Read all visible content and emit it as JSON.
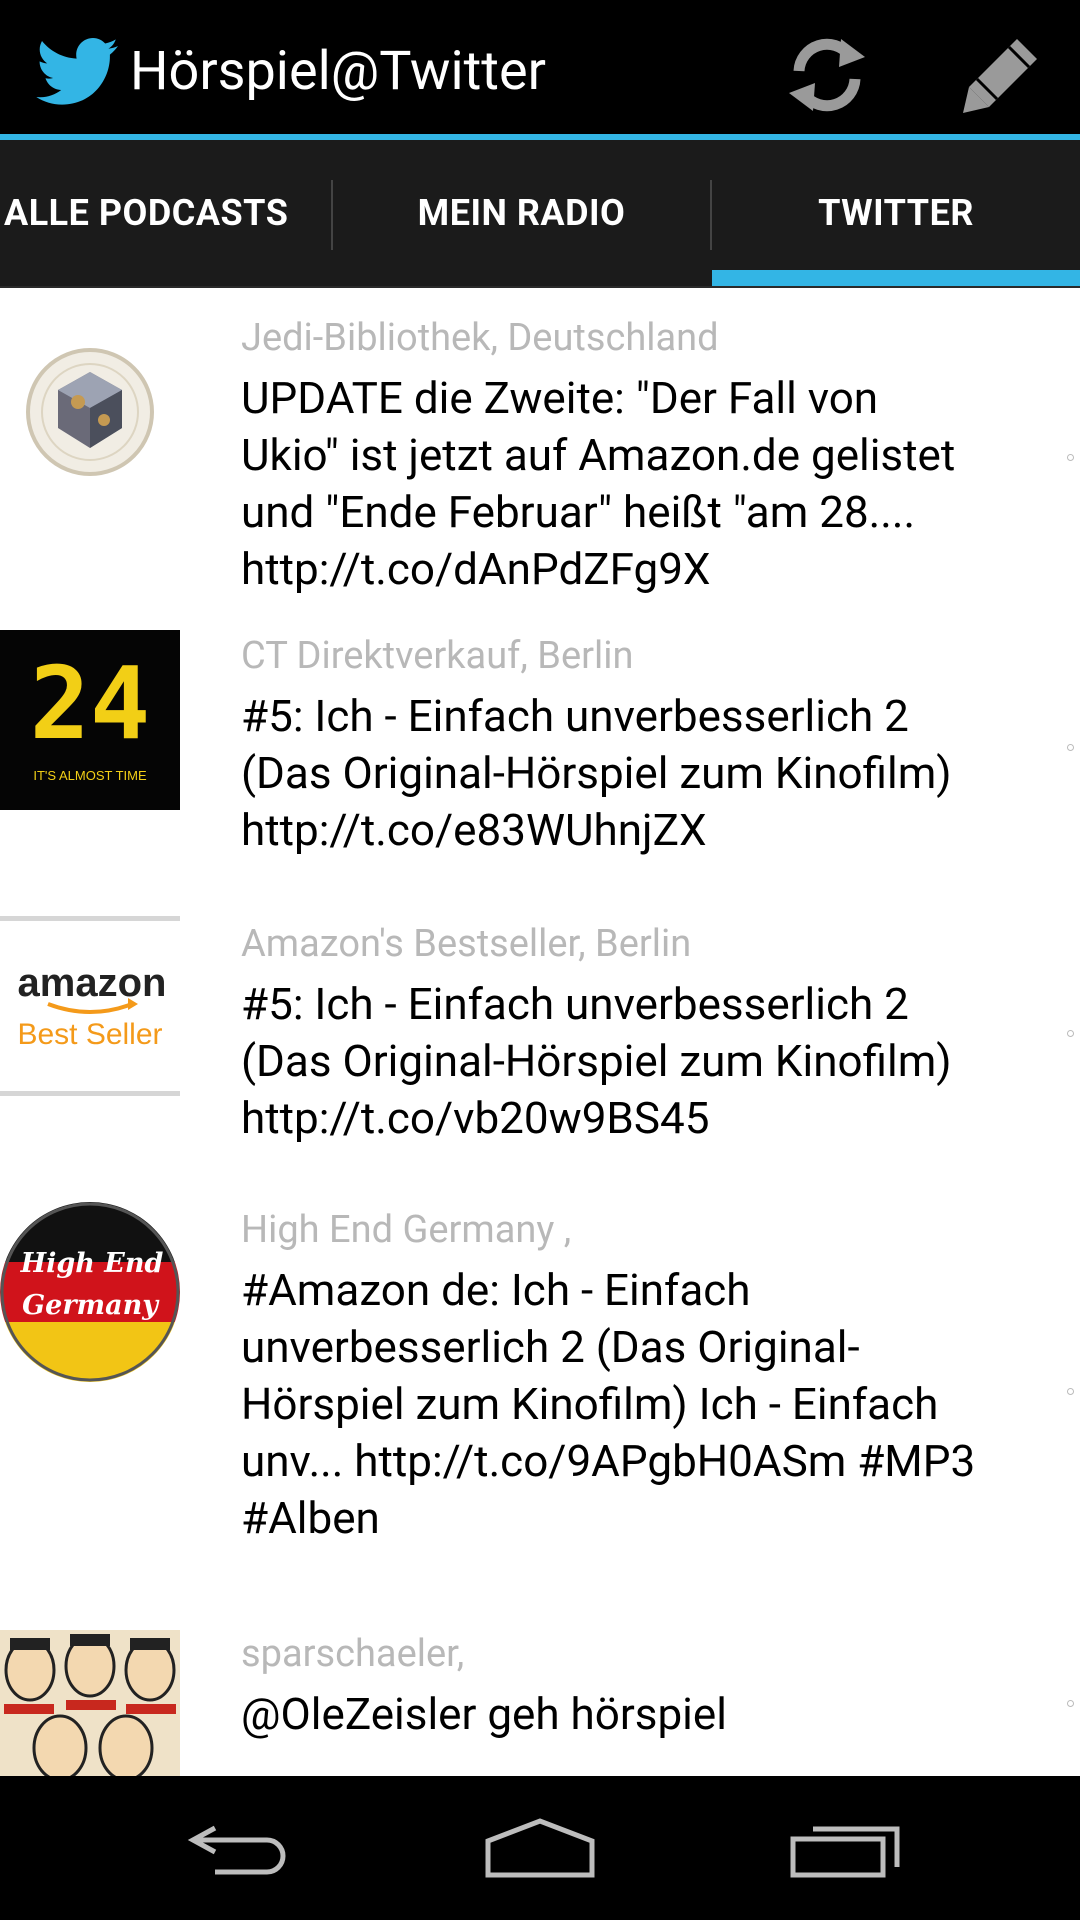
{
  "app": {
    "title": "Hörspiel@Twitter"
  },
  "colors": {
    "accent": "#33b5e5",
    "actionbar": "#000000",
    "tabbar": "#1b1b1b",
    "author": "#b8b8b8"
  },
  "tabs": [
    {
      "label": "ALLE PODCASTS",
      "selected": false
    },
    {
      "label": "MEIN RADIO",
      "selected": false
    },
    {
      "label": "TWITTER",
      "selected": true
    }
  ],
  "icons": {
    "app": "twitter-bird-icon",
    "refresh": "refresh-icon",
    "compose": "pencil-icon",
    "back": "back-icon",
    "home": "home-icon",
    "recents": "recent-apps-icon"
  },
  "tweets": [
    {
      "author": "Jedi-Bibliothek, Deutschland",
      "text": "UPDATE die Zweite: \"Der Fall von\nUkio\" ist jetzt auf Amazon.de gelistet\nund \"Ende Februar\" heißt \"am 28....\nhttp://t.co/dAnPdZFg9X"
    },
    {
      "author": "CT Direktverkauf, Berlin",
      "text": "#5: Ich - Einfach unverbesserlich 2\n(Das Original-Hörspiel zum Kinofilm)\nhttp://t.co/e83WUhnjZX",
      "avatar_text": "24",
      "avatar_caption": "IT'S ALMOST TIME"
    },
    {
      "author": "Amazon's Bestseller, Berlin",
      "text": "#5: Ich - Einfach unverbesserlich 2\n(Das Original-Hörspiel zum Kinofilm)\nhttp://t.co/vb20w9BS45",
      "avatar_text": "amazon",
      "avatar_caption": "Best Seller"
    },
    {
      "author": "High End Germany ,",
      "text": "#Amazon de: Ich - Einfach\nunverbesserlich 2 (Das Original-\nHörspiel zum Kinofilm) Ich - Einfach\nunv... http://t.co/9APgbH0ASm #MP3\n#Alben",
      "avatar_text": "High End",
      "avatar_caption": "Germany"
    },
    {
      "author": "sparschaeler,",
      "text": "@OleZeisler geh hörspiel"
    }
  ]
}
